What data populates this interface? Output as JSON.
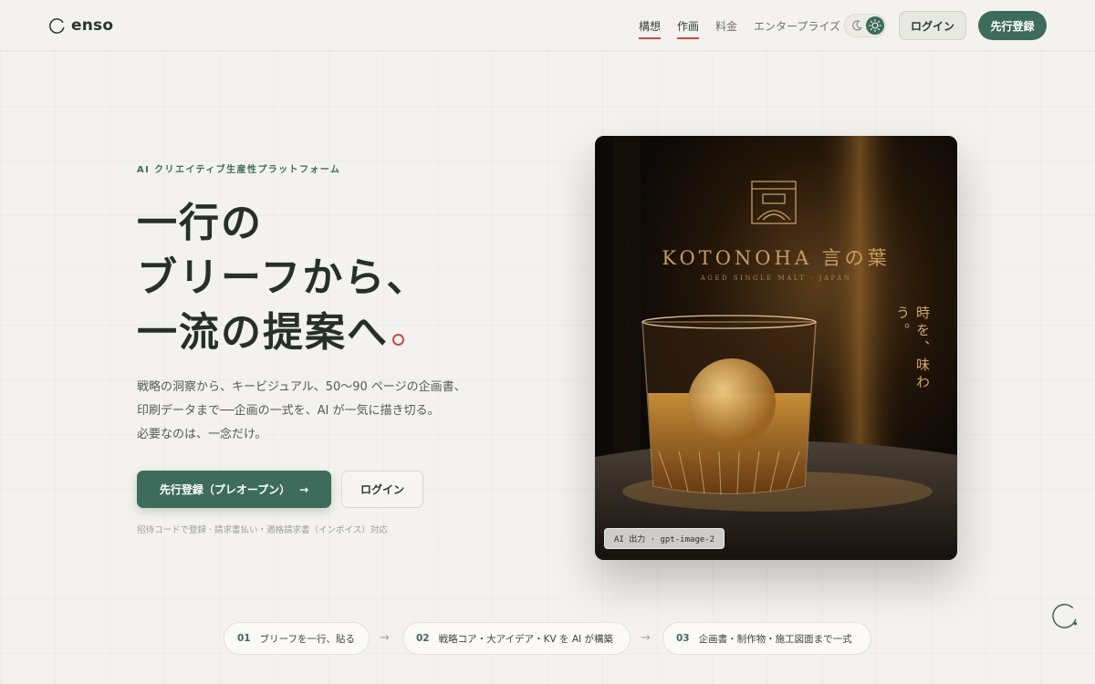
{
  "header": {
    "brand": "enso",
    "nav": [
      {
        "label": "構想",
        "active": true
      },
      {
        "label": "作画",
        "active": true
      },
      {
        "label": "料金",
        "active": false
      },
      {
        "label": "エンタープライズ",
        "active": false
      }
    ],
    "login_label": "ログイン",
    "signup_label": "先行登録"
  },
  "hero": {
    "eyebrow": "AI クリエイティブ生産性プラットフォーム",
    "headline": [
      "一行の",
      "ブリーフから、",
      "一流の提案へ"
    ],
    "description": [
      "戦略の洞察から、キービジュアル、50〜90 ページの企画書、",
      "印刷データまで──企画の一式を、AI が一気に描き切る。",
      "必要なのは、一念だけ。"
    ],
    "cta_primary": "先行登録（プレオープン）",
    "cta_primary_arrow": "→",
    "cta_secondary": "ログイン",
    "note": "招待コードで登録  ·  請求書払い・適格請求書（インボイス）対応"
  },
  "visual": {
    "brand": "KOTONOHA 言の葉",
    "subtitle": "AGED SINGLE MALT · JAPAN",
    "vertical_copy": "時を、味わう。",
    "badge": "AI 出力 · gpt-image-2"
  },
  "steps": [
    {
      "num": "01",
      "label": "ブリーフを一行、貼る"
    },
    {
      "num": "02",
      "label": "戦略コア・大アイデア・KV を AI が構築"
    },
    {
      "num": "03",
      "label": "企画書・制作物・施工図面まで一式"
    }
  ],
  "step_arrow": "→",
  "colors": {
    "background": "#f3f2ee",
    "brand_green": "#3d6b5c",
    "accent_red": "#c54e3e",
    "text_dark": "#263029"
  },
  "icons": {
    "logo": "enso-circle-icon",
    "theme_dark": "moon-icon",
    "theme_light": "sun-icon",
    "floating": "enso-circle-icon"
  }
}
